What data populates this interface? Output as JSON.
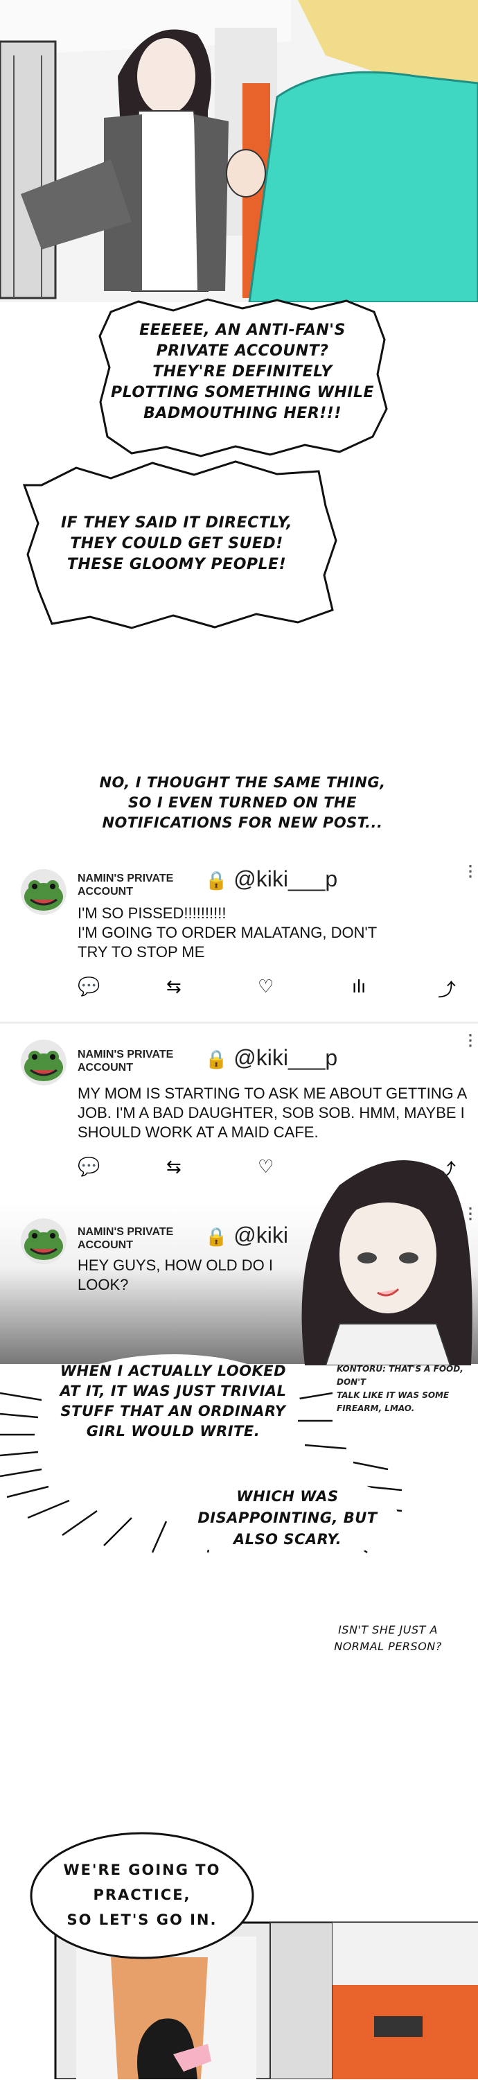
{
  "panel1": {
    "bubble1": [
      "EEEEEE, AN ANTI-FAN'S",
      "PRIVATE ACCOUNT?",
      "THEY'RE DEFINITELY",
      "PLOTTING SOMETHING WHILE",
      "BADMOUTHING HER!!!"
    ],
    "bubble2": [
      "IF THEY SAID IT DIRECTLY,",
      "THEY COULD GET SUED!",
      "THESE GLOOMY PEOPLE!"
    ]
  },
  "caption1": [
    "NO, I THOUGHT THE SAME THING,",
    "SO I EVEN TURNED ON THE",
    "NOTIFICATIONS FOR NEW POST..."
  ],
  "tweets": [
    {
      "name_line1": "NAMIN'S PRIVATE",
      "name_line2": "ACCOUNT",
      "handle": "@kiki___p",
      "body": [
        "I'M SO PISSED!!!!!!!!!!",
        "I'M GOING TO ORDER MALATANG, DON'T",
        "TRY TO STOP ME"
      ]
    },
    {
      "name_line1": "NAMIN'S PRIVATE",
      "name_line2": "ACCOUNT",
      "handle": "@kiki___p",
      "body": [
        "MY MOM IS STARTING TO ASK ME ABOUT GETTING A",
        "JOB. I'M A BAD DAUGHTER, SOB SOB. HMM, MAYBE I",
        "SHOULD WORK AT A MAID CAFE."
      ]
    },
    {
      "name_line1": "NAMIN'S PRIVATE",
      "name_line2": "ACCOUNT",
      "handle": "@kiki",
      "body": [
        "HEY GUYS, HOW OLD DO I",
        "LOOK?"
      ]
    }
  ],
  "panel3": {
    "bubble1": [
      "WHEN I ACTUALLY LOOKED",
      "AT IT, IT WAS JUST TRIVIAL",
      "STUFF THAT AN ORDINARY",
      "GIRL WOULD WRITE."
    ],
    "bubble2": [
      "WHICH WAS",
      "DISAPPOINTING, BUT",
      "ALSO SCARY."
    ],
    "note": [
      "KONTORU: THAT'S A FOOD, DON'T",
      "TALK LIKE IT WAS SOME",
      "FIREARM, LMAO."
    ],
    "aside": [
      "ISN'T SHE JUST A",
      "NORMAL PERSON?"
    ]
  },
  "panel4": {
    "bubble": [
      "WE'RE GOING TO",
      "PRACTICE,",
      "SO LET'S GO IN."
    ]
  },
  "colors": {
    "accent_teal": "#3fd6c2",
    "hair_blonde": "#f1dc8c",
    "door_orange": "#e8622c"
  }
}
